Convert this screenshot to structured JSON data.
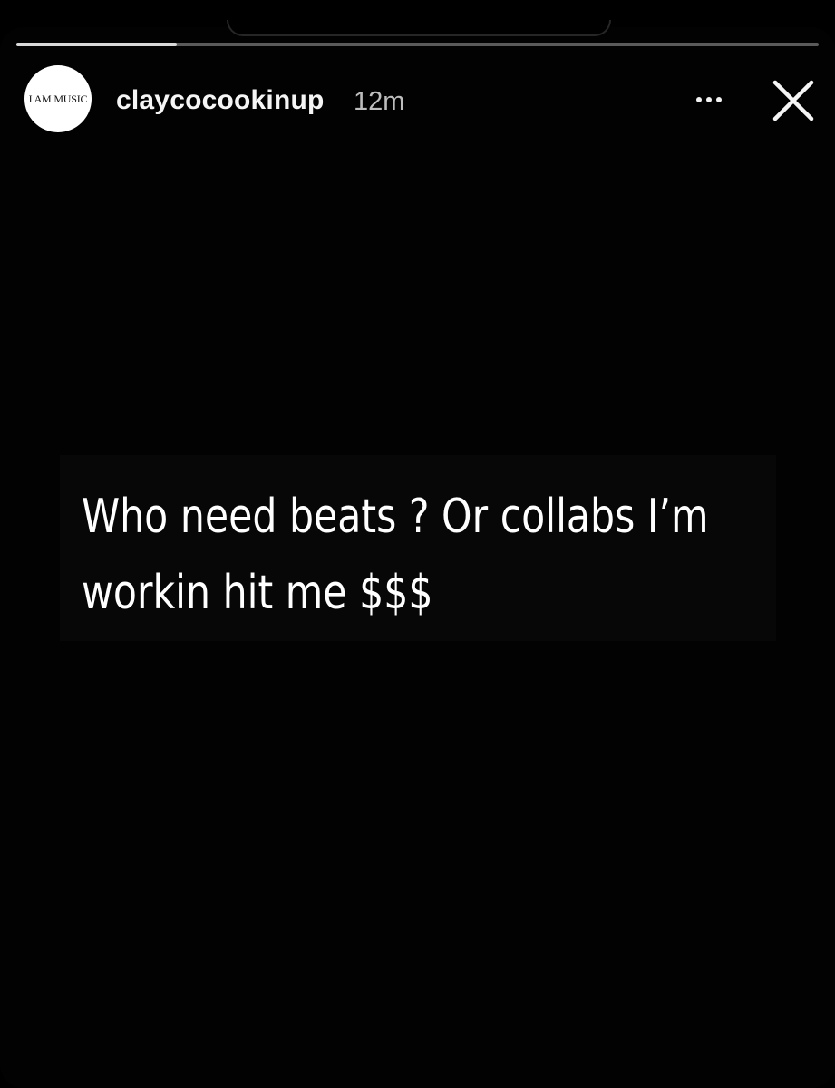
{
  "story": {
    "progress": 0.2,
    "avatar_text": "I AM MUSIC",
    "username": "claycocookinup",
    "timestamp": "12m",
    "more_icon": "more-horizontal-icon",
    "close_icon": "close-icon",
    "caption": "Who need beats ? Or collabs I’m workin hit me $$$"
  },
  "colors": {
    "background": "#000000",
    "text": "#ffffff",
    "progress_track": "#5a5a5a",
    "progress_fill": "#d9d9d9"
  }
}
